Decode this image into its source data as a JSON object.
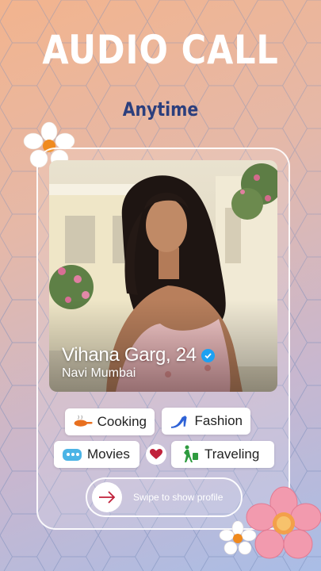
{
  "header": {
    "title": "AUDIO CALL",
    "subtitle": "Anytime"
  },
  "profile": {
    "name_age": "Vihana Garg, 24",
    "city": "Navi Mumbai",
    "verified": true
  },
  "interests": [
    {
      "label": "Cooking",
      "icon": "cooking-icon"
    },
    {
      "label": "Fashion",
      "icon": "high-heel-icon"
    },
    {
      "label": "Movies",
      "icon": "movie-icon"
    },
    {
      "label": "Traveling",
      "icon": "traveler-icon"
    }
  ],
  "match_icon": "heart-icon",
  "swipe": {
    "label": "Swipe to show profile",
    "icon": "arrow-right-icon"
  },
  "colors": {
    "accent_red": "#c0213a",
    "title_blue": "#2c3f7d",
    "verified_blue": "#1da1f2"
  }
}
